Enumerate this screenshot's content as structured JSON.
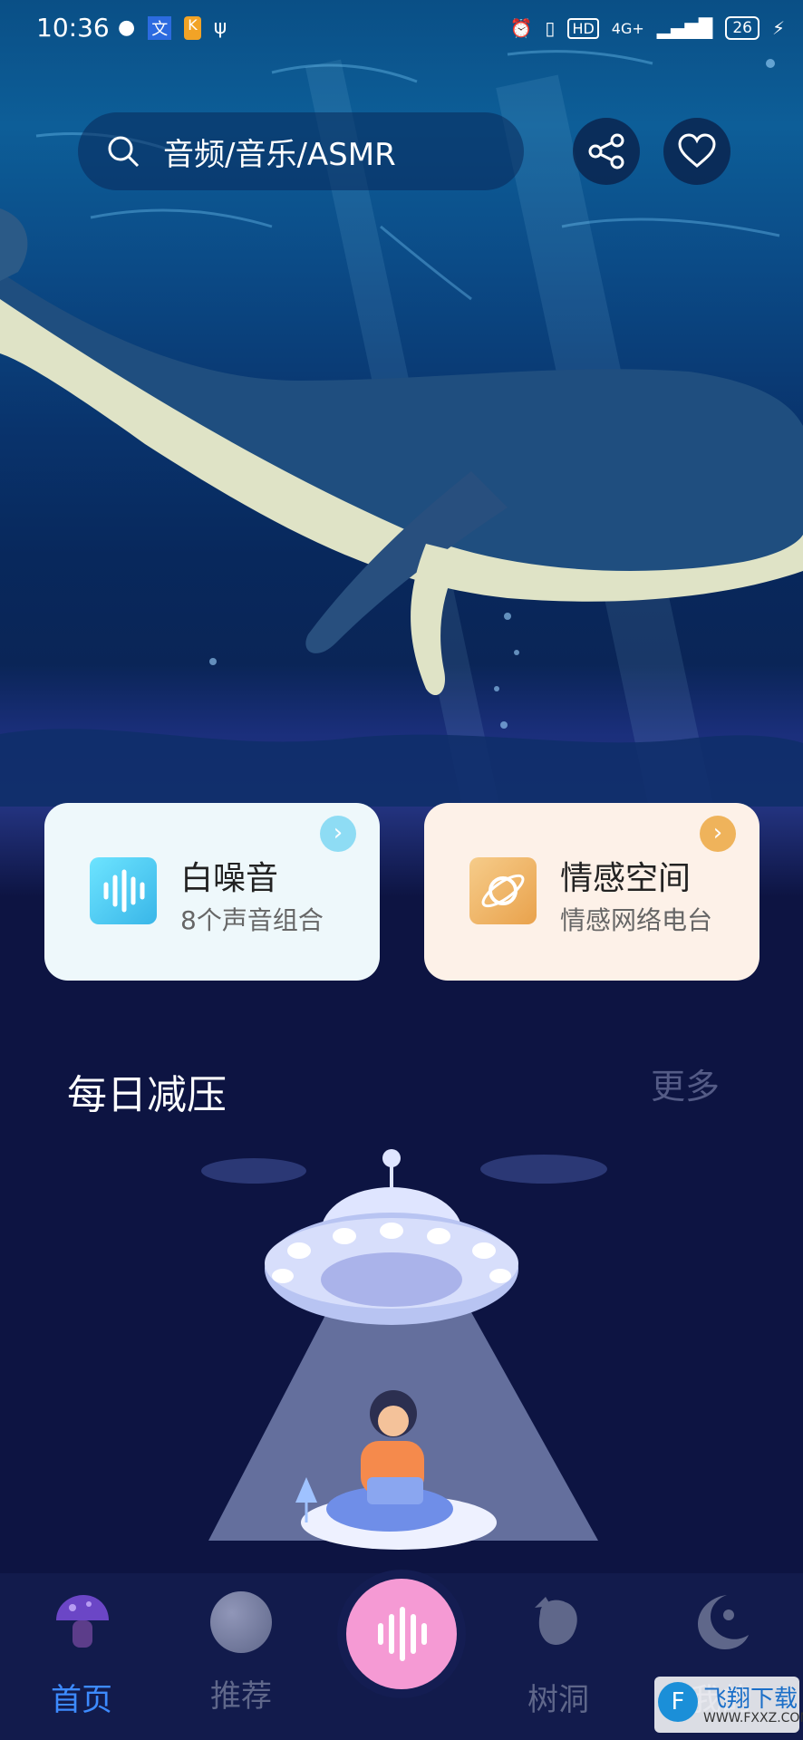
{
  "status_bar": {
    "time": "10:36",
    "network": "4G+",
    "hd": "HD",
    "battery": "26"
  },
  "search": {
    "placeholder": "音频/音乐/ASMR"
  },
  "cards": [
    {
      "title": "白噪音",
      "subtitle": "8个声音组合",
      "accent": "#5ad3f0"
    },
    {
      "title": "情感空间",
      "subtitle": "情感网络电台",
      "accent": "#f0b96a"
    }
  ],
  "section": {
    "title": "每日减压",
    "more": "更多"
  },
  "nav": {
    "items": [
      {
        "label": "首页",
        "icon": "mushroom-icon",
        "active": true
      },
      {
        "label": "推荐",
        "icon": "moon-planet-icon",
        "active": false
      },
      {
        "label": "",
        "icon": "soundwave-icon",
        "active": false
      },
      {
        "label": "树洞",
        "icon": "tree-hole-icon",
        "active": false
      },
      {
        "label": "我的",
        "icon": "moon-person-icon",
        "active": false
      }
    ]
  },
  "watermark": {
    "text": "飞翔下载",
    "url": "WWW.FXXZ.COM"
  },
  "colors": {
    "active": "#3d8bff",
    "inactive": "#5f678a",
    "center_button": "#f59ad4",
    "background": "#0d1442"
  }
}
